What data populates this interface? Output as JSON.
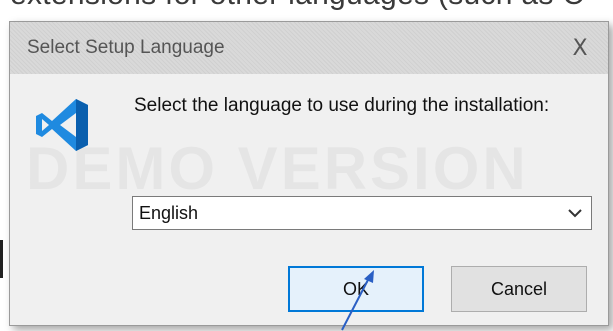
{
  "background": {
    "text": "extensions for other languages (such as C"
  },
  "dialog": {
    "title": "Select Setup Language",
    "close_label": "X",
    "watermark": "DEMO VERSION",
    "prompt": "Select the language to use during the installation:",
    "language": {
      "selected": "English"
    },
    "ok_label": "OK",
    "cancel_label": "Cancel",
    "icon": "vscode-logo-icon"
  },
  "colors": {
    "accent": "#0078d7",
    "logo_blue": "#1f8ae0",
    "logo_dark": "#0a5fae"
  }
}
